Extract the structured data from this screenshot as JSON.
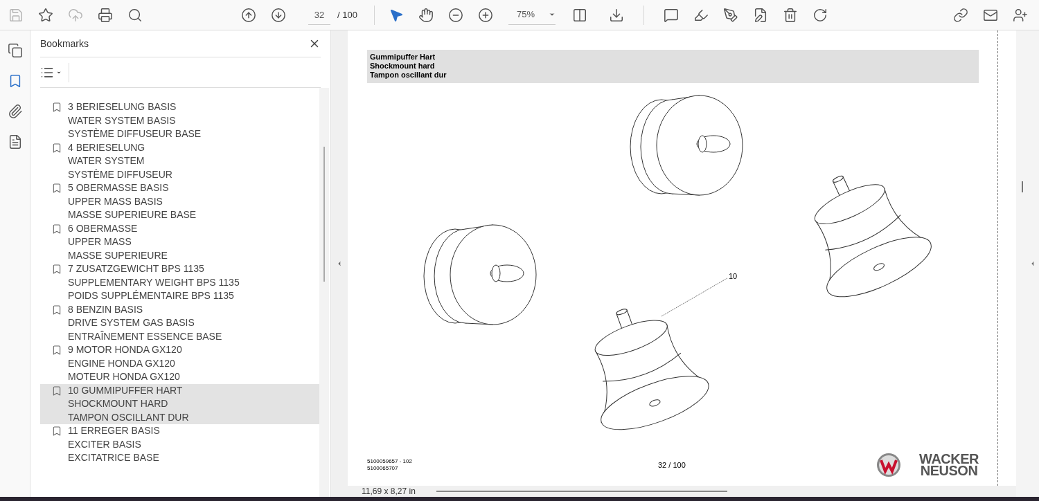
{
  "toolbar": {
    "page_value": "32",
    "page_total": "/ 100",
    "zoom": "75%",
    "tools": [
      {
        "kind": "select",
        "selected": true
      },
      {
        "kind": "hand",
        "selected": false
      }
    ]
  },
  "rail": [
    {
      "kind": "pages",
      "selected": false
    },
    {
      "kind": "bookmarks",
      "selected": true
    },
    {
      "kind": "attachments",
      "selected": false
    },
    {
      "kind": "info",
      "selected": false
    }
  ],
  "bookmarks": {
    "title": "Bookmarks",
    "items": [
      {
        "lines": [
          "3 BERIESELUNG BASIS",
          "WATER SYSTEM BASIS",
          "SYSTÈME DIFFUSEUR BASE"
        ],
        "selected": false
      },
      {
        "lines": [
          "4 BERIESELUNG",
          "WATER SYSTEM",
          "SYSTÈME DIFFUSEUR"
        ],
        "selected": false
      },
      {
        "lines": [
          "5 OBERMASSE BASIS",
          "UPPER MASS BASIS",
          "MASSE SUPERIEURE BASE"
        ],
        "selected": false
      },
      {
        "lines": [
          "6 OBERMASSE",
          "UPPER MASS",
          "MASSE SUPERIEURE"
        ],
        "selected": false
      },
      {
        "lines": [
          "7 ZUSATZGEWICHT BPS 1135",
          "SUPPLEMENTARY WEIGHT BPS 1135",
          "POIDS SUPPLÉMENTAIRE BPS 1135"
        ],
        "selected": false
      },
      {
        "lines": [
          "8 BENZIN BASIS",
          "DRIVE SYSTEM GAS BASIS",
          "ENTRAÎNEMENT ESSENCE BASE"
        ],
        "selected": false
      },
      {
        "lines": [
          "9 MOTOR HONDA GX120",
          "ENGINE HONDA GX120",
          "MOTEUR HONDA GX120"
        ],
        "selected": false
      },
      {
        "lines": [
          "10 GUMMIPUFFER HART",
          "SHOCKMOUNT HARD",
          "TAMPON OSCILLANT DUR"
        ],
        "selected": true
      },
      {
        "lines": [
          "11 ERREGER BASIS",
          "EXCITER BASIS",
          "EXCITATRICE BASE"
        ],
        "selected": false
      }
    ]
  },
  "document": {
    "header_lines": [
      "Gummipuffer Hart",
      "Shockmount hard",
      "Tampon oscillant dur"
    ],
    "callout": "10",
    "part_numbers": [
      "5100059657 - 102",
      "5100065707"
    ],
    "page_number": "32 / 100",
    "logo_lines": [
      "WACKER",
      "NEUSON"
    ]
  },
  "status_bar": {
    "page_size": "11,69 x 8,27 in"
  }
}
